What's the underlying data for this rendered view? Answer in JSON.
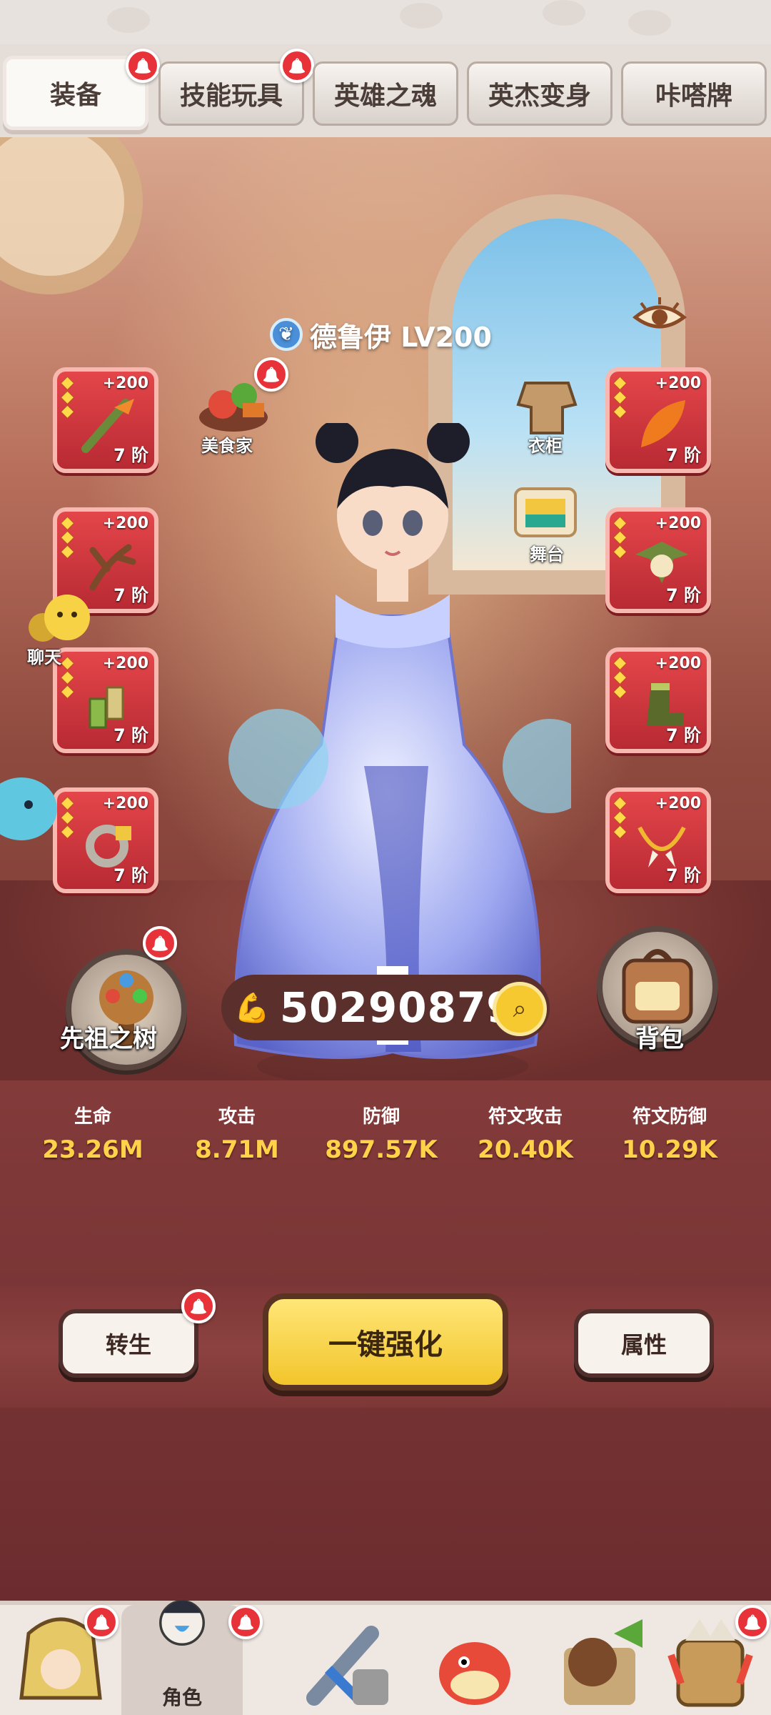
{
  "tabs": [
    {
      "label": "装备",
      "active": true,
      "badge": true
    },
    {
      "label": "技能玩具",
      "active": false,
      "badge": true
    },
    {
      "label": "英雄之魂",
      "active": false,
      "badge": false
    },
    {
      "label": "英杰变身",
      "active": false,
      "badge": false
    },
    {
      "label": "咔嗒牌",
      "active": false,
      "badge": false
    }
  ],
  "hero": {
    "name_level": "德鲁伊 LV200",
    "class_icon": "druid-icon"
  },
  "side_labels": {
    "gourmet": "美食家",
    "wardrobe": "衣柜",
    "stage": "舞台",
    "chat": "聊天"
  },
  "equipment_left": [
    {
      "plus": "+200",
      "tier": "7 阶",
      "icon": "staff-icon"
    },
    {
      "plus": "+200",
      "tier": "7 阶",
      "icon": "antler-icon"
    },
    {
      "plus": "+200",
      "tier": "7 阶",
      "icon": "bamboo-icon"
    },
    {
      "plus": "+200",
      "tier": "7 阶",
      "icon": "ring-icon"
    }
  ],
  "equipment_right": [
    {
      "plus": "+200",
      "tier": "7 阶",
      "icon": "leaf-icon"
    },
    {
      "plus": "+200",
      "tier": "7 阶",
      "icon": "leaf-mask-icon"
    },
    {
      "plus": "+200",
      "tier": "7 阶",
      "icon": "boot-icon"
    },
    {
      "plus": "+200",
      "tier": "7 阶",
      "icon": "fang-necklace-icon"
    }
  ],
  "ancestor_tree": {
    "label": "先祖之树"
  },
  "backpack": {
    "label": "背包"
  },
  "power": {
    "value": "50290879"
  },
  "stats": [
    {
      "label": "生命",
      "value": "23.26M"
    },
    {
      "label": "攻击",
      "value": "8.71M"
    },
    {
      "label": "防御",
      "value": "897.57K"
    },
    {
      "label": "符文攻击",
      "value": "20.40K"
    },
    {
      "label": "符文防御",
      "value": "10.29K"
    }
  ],
  "actions": {
    "rebirth": "转生",
    "upgrade_all": "一键强化",
    "attributes": "属性"
  },
  "bottom_nav": [
    {
      "label": "",
      "icon": "yak-hero-icon",
      "badge": true
    },
    {
      "label": "角色",
      "icon": "character-icon",
      "badge": true,
      "active": true
    },
    {
      "label": "",
      "icon": "weapon-icon",
      "badge": false
    },
    {
      "label": "",
      "icon": "dino-pet-icon",
      "badge": false
    },
    {
      "label": "",
      "icon": "bear-shop-icon",
      "badge": false
    },
    {
      "label": "",
      "icon": "totem-icon",
      "badge": true
    }
  ],
  "colors": {
    "accent_gold": "#f2c52b",
    "slot_red": "#d93a40",
    "stat_value": "#ffd24a",
    "badge_red": "#e8323a"
  }
}
